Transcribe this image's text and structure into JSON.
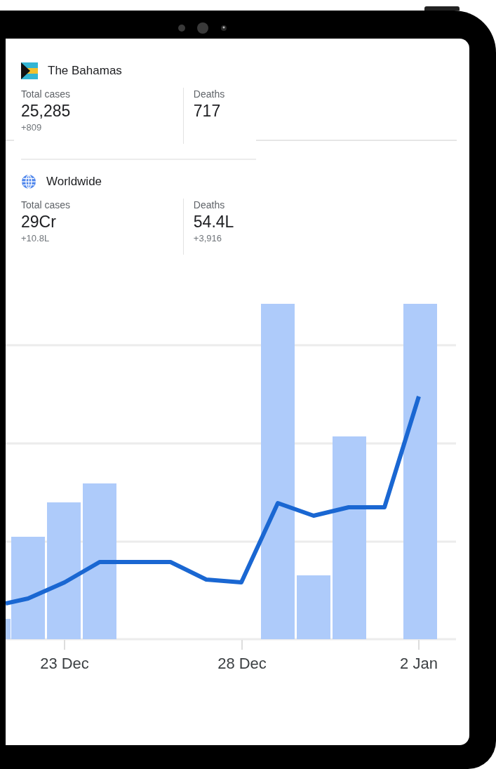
{
  "regions": [
    {
      "kind": "flag",
      "name": "The Bahamas",
      "stats": [
        {
          "label": "Total cases",
          "value": "25,285",
          "change": "+809"
        },
        {
          "label": "Deaths",
          "value": "717"
        }
      ]
    },
    {
      "kind": "globe",
      "name": "Worldwide",
      "stats": [
        {
          "label": "Total cases",
          "value": "29Cr",
          "change": "+10.8L"
        },
        {
          "label": "Deaths",
          "value": "54.4L",
          "change": "+3,916"
        }
      ]
    }
  ],
  "chart": {
    "x_labels": [
      "23 Dec",
      "28 Dec",
      "2 Jan"
    ]
  }
}
